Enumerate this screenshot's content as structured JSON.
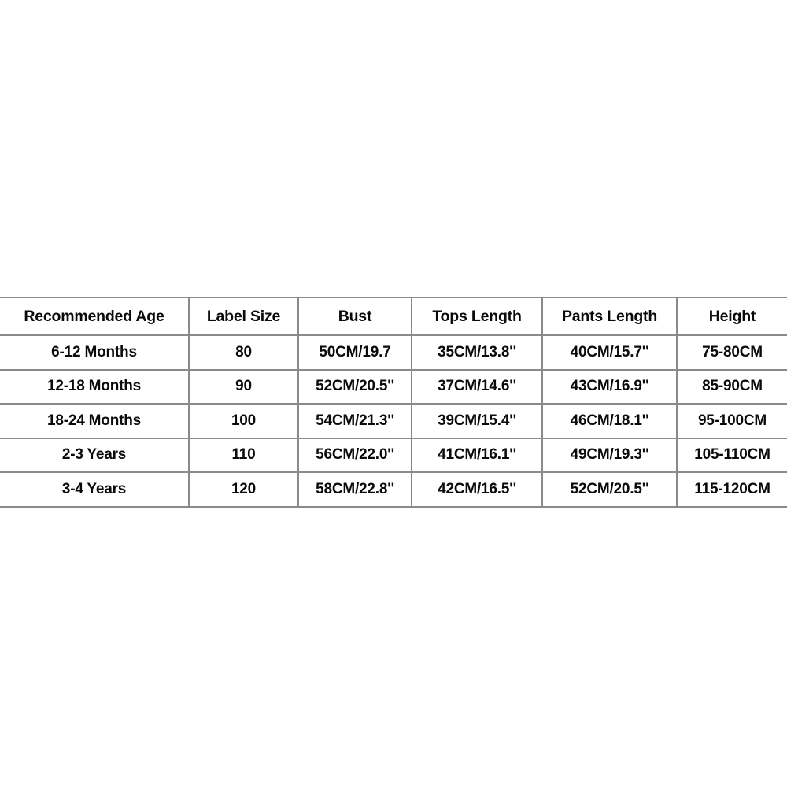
{
  "chart_data": {
    "type": "table",
    "title": "",
    "columns": [
      "Recommended Age",
      "Label Size",
      "Bust",
      "Tops Length",
      "Pants Length",
      "Height"
    ],
    "rows": [
      [
        "6-12 Months",
        "80",
        "50CM/19.7",
        "35CM/13.8''",
        "40CM/15.7''",
        "75-80CM"
      ],
      [
        "12-18 Months",
        "90",
        "52CM/20.5''",
        "37CM/14.6''",
        "43CM/16.9''",
        "85-90CM"
      ],
      [
        "18-24 Months",
        "100",
        "54CM/21.3''",
        "39CM/15.4''",
        "46CM/18.1''",
        "95-100CM"
      ],
      [
        "2-3 Years",
        "110",
        "56CM/22.0''",
        "41CM/16.1''",
        "49CM/19.3''",
        "105-110CM"
      ],
      [
        "3-4 Years",
        "120",
        "58CM/22.8''",
        "42CM/16.5''",
        "52CM/20.5''",
        "115-120CM"
      ]
    ]
  },
  "style": {
    "border_color": "#8a8a8a",
    "text_color": "#0a0a0a",
    "background": "#ffffff"
  }
}
